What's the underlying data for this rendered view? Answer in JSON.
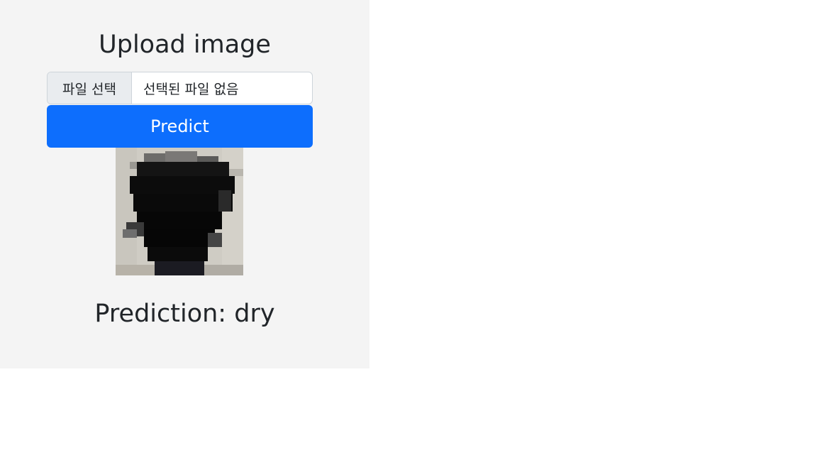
{
  "page": {
    "title": "Upload image",
    "file_input": {
      "button_label": "파일 선택",
      "status_text": "선택된 파일 없음"
    },
    "predict_button_label": "Predict",
    "image": "uploaded-scalp-photo",
    "prediction_label": "Prediction:",
    "prediction_value": "dry"
  },
  "colors": {
    "panel_background": "#f4f4f4",
    "primary_button": "#0d6efd",
    "text": "#212529"
  }
}
